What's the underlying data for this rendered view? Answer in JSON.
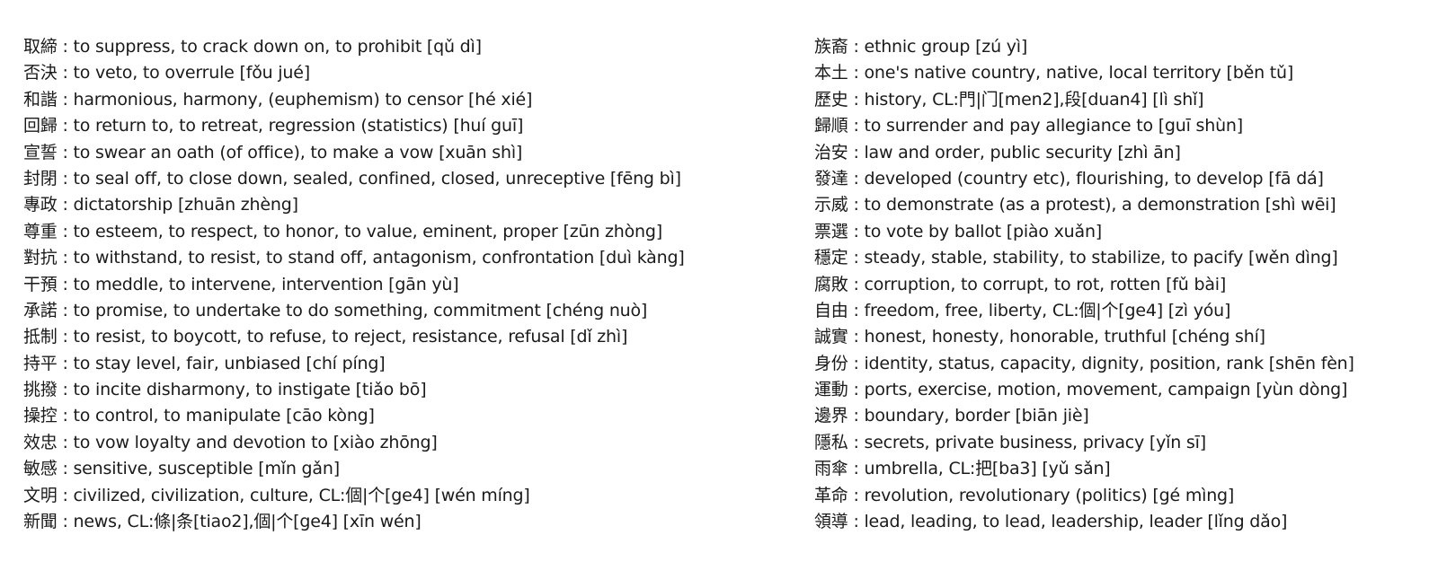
{
  "left_column": [
    {
      "text": "取締 : to suppress, to crack down on, to prohibit  [qǔ dì]"
    },
    {
      "text": "否決 : to veto, to overrule  [fǒu jué]"
    },
    {
      "text": "和諧 : harmonious, harmony, (euphemism) to censor  [hé xié]"
    },
    {
      "text": "回歸 : to return to, to retreat, regression (statistics)  [huí guī]"
    },
    {
      "text": "宣誓 : to swear an oath (of office), to make a vow  [xuān shì]"
    },
    {
      "text": "封閉 : to seal off, to close down, sealed, confined, closed, unreceptive  [fēng bì]"
    },
    {
      "text": "專政 : dictatorship  [zhuān zhèng]"
    },
    {
      "text": "尊重 : to esteem, to respect, to honor, to value, eminent, proper  [zūn zhòng]"
    },
    {
      "text": "對抗 : to withstand, to resist, to stand off, antagonism, confrontation  [duì kàng]"
    },
    {
      "text": "干預 : to meddle, to intervene, intervention  [gān yù]"
    },
    {
      "text": "承諾 : to promise, to undertake to do something, commitment  [chéng nuò]"
    },
    {
      "text": "抵制 : to resist, to boycott, to refuse, to reject, resistance, refusal  [dǐ zhì]"
    },
    {
      "text": "持平 : to stay level, fair, unbiased  [chí píng]"
    },
    {
      "text": "挑撥 : to incite disharmony, to instigate  [tiǎo bō]"
    },
    {
      "text": "操控 : to control, to manipulate  [cāo kòng]"
    },
    {
      "text": "效忠 : to vow loyalty and devotion to  [xiào zhōng]"
    },
    {
      "text": "敏感 : sensitive, susceptible  [mǐn gǎn]"
    },
    {
      "text": "文明 : civilized, civilization, culture, CL:個|个[ge4]  [wén míng]"
    },
    {
      "text": "新聞 : news, CL:條|条[tiao2],個|个[ge4]  [xīn wén]"
    }
  ],
  "right_column": [
    {
      "text": "族裔 : ethnic group  [zú yì]"
    },
    {
      "text": "本土 : one's native country, native, local territory  [běn tǔ]"
    },
    {
      "text": "歷史 : history, CL:門|门[men2],段[duan4]  [lì shǐ]"
    },
    {
      "text": "歸順 : to surrender and pay allegiance to  [guī shùn]"
    },
    {
      "text": "治安 : law and order, public security  [zhì ān]"
    },
    {
      "text": "發達 : developed (country etc), flourishing, to develop  [fā dá]"
    },
    {
      "text": "示威 : to demonstrate (as a protest), a demonstration [shì wēi]"
    },
    {
      "text": "票選 : to vote by ballot  [piào xuǎn]"
    },
    {
      "text": "穩定 : steady, stable, stability, to stabilize, to pacify  [wěn dìng]"
    },
    {
      "text": "腐敗 : corruption, to corrupt, to rot, rotten  [fǔ bài]"
    },
    {
      "text": "自由 : freedom, free, liberty, CL:個|个[ge4]  [zì yóu]"
    },
    {
      "text": "誠實 : honest, honesty, honorable, truthful  [chéng shí]"
    },
    {
      "text": "身份 : identity, status, capacity, dignity, position, rank  [shēn fèn]"
    },
    {
      "text": "運動 : ports, exercise, motion, movement, campaign [yùn dòng]"
    },
    {
      "text": "邊界 : boundary, border  [biān jiè]"
    },
    {
      "text": "隱私 : secrets, private business, privacy  [yǐn sī]"
    },
    {
      "text": "雨傘 : umbrella, CL:把[ba3]  [yǔ sǎn]"
    },
    {
      "text": "革命 : revolution, revolutionary (politics)  [gé mìng]"
    },
    {
      "text": "領導 : lead, leading, to lead, leadership, leader  [lǐng dǎo]"
    }
  ]
}
